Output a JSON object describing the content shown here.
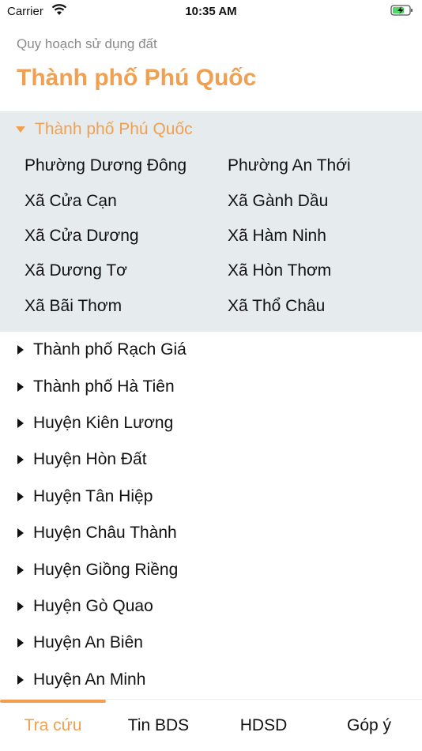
{
  "status": {
    "carrier": "Carrier",
    "time": "10:35 AM"
  },
  "header": {
    "subtitle": "Quy hoạch sử dụng đất",
    "title": "Thành phố Phú Quốc"
  },
  "tree": {
    "expanded": {
      "label": "Thành phố Phú Quốc",
      "wards": [
        "Phường Dương Đông",
        "Phường An Thới",
        "Xã Cửa Cạn",
        "Xã Gành Dầu",
        "Xã Cửa Dương",
        "Xã Hàm Ninh",
        "Xã Dương Tơ",
        "Xã Hòn Thơm",
        "Xã Bãi Thơm",
        "Xã Thổ Châu"
      ]
    },
    "collapsed": [
      "Thành phố Rạch Giá",
      "Thành phố Hà Tiên",
      "Huyện Kiên Lương",
      "Huyện Hòn Đất",
      "Huyện Tân Hiệp",
      "Huyện Châu Thành",
      "Huyện Giồng Riềng",
      "Huyện Gò Quao",
      "Huyện An Biên",
      "Huyện An Minh"
    ]
  },
  "tabs": [
    {
      "label": "Tra cứu",
      "active": true
    },
    {
      "label": "Tin BDS",
      "active": false
    },
    {
      "label": "HDSD",
      "active": false
    },
    {
      "label": "Góp ý",
      "active": false
    }
  ],
  "colors": {
    "accent": "#f0a050",
    "expanded_bg": "#e6ebee"
  }
}
